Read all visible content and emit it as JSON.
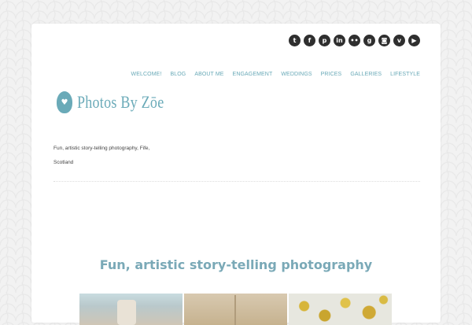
{
  "social": [
    {
      "icon": "twitter-icon",
      "glyph": "t"
    },
    {
      "icon": "facebook-icon",
      "glyph": "f"
    },
    {
      "icon": "pinterest-icon",
      "glyph": "p"
    },
    {
      "icon": "linkedin-icon",
      "glyph": "in"
    },
    {
      "icon": "flickr-icon",
      "glyph": "••"
    },
    {
      "icon": "google-plus-icon",
      "glyph": "g"
    },
    {
      "icon": "instagram-icon",
      "glyph": "◙"
    },
    {
      "icon": "vimeo-icon",
      "glyph": "v"
    },
    {
      "icon": "youtube-icon",
      "glyph": "▶"
    }
  ],
  "nav": [
    "WELCOME!",
    "BLOG",
    "ABOUT ME",
    "ENGAGEMENT",
    "WEDDINGS",
    "PRICES",
    "GALLERIES",
    "LIFESTYLE"
  ],
  "logo": {
    "text": "Photos By Zōe",
    "badge_glyph": "♥"
  },
  "tagline": {
    "line1": "Fun, artistic story-telling photography, Fife,",
    "line2": "Scotland"
  },
  "headline": "Fun, artistic story-telling photography",
  "colors": {
    "accent": "#6aaab8",
    "headline": "#7aa9b7",
    "icon_bg": "#2f2f2f"
  }
}
